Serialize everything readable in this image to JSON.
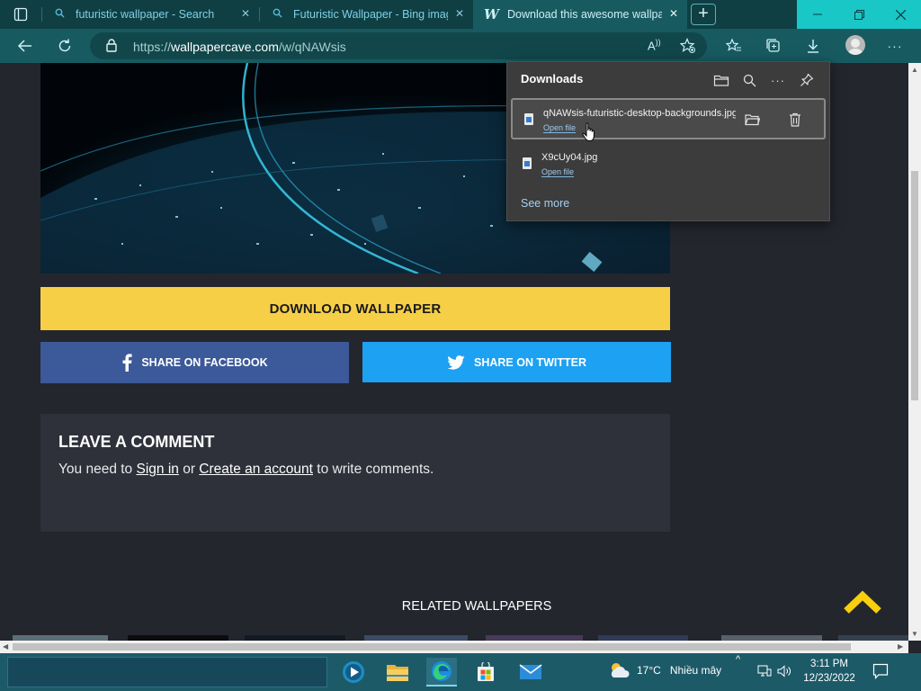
{
  "tabs": [
    {
      "title": "futuristic wallpaper - Search",
      "icon": "search-icon"
    },
    {
      "title": "Futuristic Wallpaper - Bing images",
      "icon": "search-icon"
    },
    {
      "title": "Download this awesome wallpaper",
      "icon": "W",
      "active": true
    }
  ],
  "newtab_label": "+",
  "address": {
    "prefix": "https://",
    "domain": "wallpapercave.com",
    "path": "/w/qNAWsis"
  },
  "page": {
    "download_button": "DOWNLOAD WALLPAPER",
    "share_facebook": "SHARE ON FACEBOOK",
    "share_twitter": "SHARE ON TWITTER",
    "comment_title": "LEAVE A COMMENT",
    "comment_prefix": "You need to ",
    "signin_link": "Sign in",
    "comment_or": " or ",
    "create_account_link": "Create an account",
    "comment_suffix": " to write comments.",
    "related_title": "RELATED WALLPAPERS"
  },
  "downloads": {
    "title": "Downloads",
    "items": [
      {
        "filename": "qNAWsis-futuristic-desktop-backgrounds.jpg",
        "action": "Open file"
      },
      {
        "filename": "X9cUy04.jpg",
        "action": "Open file"
      }
    ],
    "see_more": "See more"
  },
  "taskbar": {
    "temperature": "17°C",
    "weather_text": "Nhiều mây",
    "time": "3:11 PM",
    "date": "12/23/2022"
  },
  "colors": {
    "accent_yellow": "#f7cf47",
    "facebook_blue": "#3c5a99",
    "twitter_blue": "#1da1f2",
    "tab_strip": "#0f3f43",
    "toolbar": "#175b60",
    "window_controls": "#19c7c7"
  }
}
